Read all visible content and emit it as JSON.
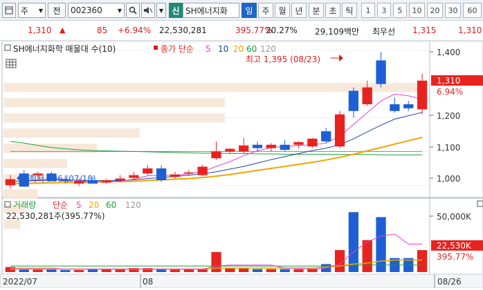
{
  "toolbar": {
    "market": "주",
    "period_label": "전",
    "code": "002360",
    "stock_name_tag": "신",
    "stock_name": "SH에너지화",
    "periods": [
      "일",
      "주",
      "월",
      "년",
      "분",
      "초",
      "틱"
    ],
    "active_period": "일",
    "intervals": [
      "1",
      "3",
      "5",
      "10",
      "20",
      "30",
      "60"
    ]
  },
  "quote": {
    "price": "1,310",
    "change": "85",
    "change_pct": "+6.94%",
    "volume": "22,530,281",
    "volume_ratio": "395.77%",
    "turnover": "20.27%",
    "amount": "29,109백만",
    "bid_label": "최우선",
    "bid_price": "1,315",
    "ask_price": "1,310"
  },
  "price_panel": {
    "title": "SH에너지화학 매물대 수(10)",
    "ma_label": "종가 단순",
    "ma_periods": [
      "5",
      "10",
      "20",
      "60",
      "120"
    ],
    "high_annotation": "최고 1,395 (08/23)",
    "low_annotation": "최저 996 (07/18)",
    "current_price_tag": "1,310",
    "current_pct_tag": "6.94%",
    "y_ticks": [
      "1,400",
      "1,300",
      "1,200",
      "1,100",
      "1,000"
    ]
  },
  "volume_panel": {
    "title_label": "거래량",
    "ma_label": "단순",
    "ma_periods": [
      "5",
      "20",
      "60",
      "120"
    ],
    "volume_text": "22,530,281주(395.77%)",
    "y_ticks": [
      "50,000K"
    ],
    "current_volume_tag": "22,530K",
    "current_pct_tag": "395.77%"
  },
  "x_axis": {
    "labels": [
      "2022/07",
      "08",
      "08/26"
    ]
  },
  "colors": {
    "up": "#e8231f",
    "down": "#1e5fd6",
    "ma5": "#e83cc9",
    "ma10": "#1f3fa8",
    "ma20": "#f0a500",
    "ma60": "#1a9e3a",
    "ma120": "#8a8a8a"
  },
  "chart_data": {
    "type": "candlestick",
    "ylim": [
      970,
      1420
    ],
    "candles": [
      {
        "o": 1000,
        "h": 1030,
        "l": 990,
        "c": 1018
      },
      {
        "o": 1035,
        "h": 1045,
        "l": 995,
        "c": 996
      },
      {
        "o": 1030,
        "h": 1040,
        "l": 1020,
        "c": 1035
      },
      {
        "o": 1035,
        "h": 1040,
        "l": 1012,
        "c": 1012
      },
      {
        "o": 1015,
        "h": 1030,
        "l": 1005,
        "c": 1012
      },
      {
        "o": 1005,
        "h": 1020,
        "l": 998,
        "c": 1013
      },
      {
        "o": 1015,
        "h": 1025,
        "l": 1008,
        "c": 1005
      },
      {
        "o": 1008,
        "h": 1020,
        "l": 1005,
        "c": 1015
      },
      {
        "o": 1015,
        "h": 1030,
        "l": 1010,
        "c": 1020
      },
      {
        "o": 1022,
        "h": 1040,
        "l": 1018,
        "c": 1030
      },
      {
        "o": 1035,
        "h": 1060,
        "l": 1030,
        "c": 1050
      },
      {
        "o": 1050,
        "h": 1060,
        "l": 1010,
        "c": 1015
      },
      {
        "o": 1025,
        "h": 1040,
        "l": 1020,
        "c": 1032
      },
      {
        "o": 1035,
        "h": 1045,
        "l": 1028,
        "c": 1038
      },
      {
        "o": 1030,
        "h": 1060,
        "l": 1028,
        "c": 1055
      },
      {
        "o": 1080,
        "h": 1130,
        "l": 1075,
        "c": 1100
      },
      {
        "o": 1100,
        "h": 1110,
        "l": 1095,
        "c": 1108
      },
      {
        "o": 1100,
        "h": 1140,
        "l": 1095,
        "c": 1118
      },
      {
        "o": 1120,
        "h": 1130,
        "l": 1100,
        "c": 1110
      },
      {
        "o": 1110,
        "h": 1125,
        "l": 1100,
        "c": 1120
      },
      {
        "o": 1120,
        "h": 1135,
        "l": 1100,
        "c": 1105
      },
      {
        "o": 1120,
        "h": 1130,
        "l": 1110,
        "c": 1128
      },
      {
        "o": 1115,
        "h": 1140,
        "l": 1110,
        "c": 1138
      },
      {
        "o": 1160,
        "h": 1170,
        "l": 1125,
        "c": 1130
      },
      {
        "o": 1115,
        "h": 1220,
        "l": 1110,
        "c": 1210
      },
      {
        "o": 1280,
        "h": 1290,
        "l": 1200,
        "c": 1220
      },
      {
        "o": 1240,
        "h": 1310,
        "l": 1235,
        "c": 1290
      },
      {
        "o": 1370,
        "h": 1395,
        "l": 1290,
        "c": 1300
      },
      {
        "o": 1240,
        "h": 1260,
        "l": 1215,
        "c": 1220
      },
      {
        "o": 1240,
        "h": 1250,
        "l": 1220,
        "c": 1228
      },
      {
        "o": 1225,
        "h": 1330,
        "l": 1210,
        "c": 1310
      }
    ],
    "ma5": [
      1010,
      1014,
      1016,
      1019,
      1018,
      1014,
      1012,
      1010,
      1012,
      1018,
      1028,
      1030,
      1030,
      1034,
      1040,
      1056,
      1070,
      1088,
      1102,
      1112,
      1115,
      1118,
      1120,
      1125,
      1145,
      1180,
      1215,
      1250,
      1270,
      1265,
      1255
    ],
    "ma10": [
      1012,
      1013,
      1014,
      1015,
      1016,
      1015,
      1014,
      1014,
      1014,
      1016,
      1020,
      1023,
      1026,
      1030,
      1034,
      1040,
      1048,
      1056,
      1066,
      1076,
      1085,
      1094,
      1103,
      1110,
      1120,
      1138,
      1158,
      1178,
      1196,
      1206,
      1216
    ],
    "ma20": [
      1005,
      1005,
      1006,
      1007,
      1008,
      1008,
      1009,
      1010,
      1011,
      1012,
      1014,
      1016,
      1018,
      1020,
      1023,
      1027,
      1032,
      1038,
      1044,
      1050,
      1056,
      1062,
      1068,
      1075,
      1083,
      1092,
      1102,
      1112,
      1122,
      1132,
      1142
    ],
    "ma60": [
      1130,
      1125,
      1118,
      1112,
      1108,
      1105,
      1103,
      1102,
      1101,
      1100,
      1099,
      1098,
      1097,
      1096,
      1095,
      1095,
      1094,
      1094,
      1093,
      1093,
      1092,
      1092,
      1092,
      1092,
      1091,
      1091,
      1091,
      1090,
      1090,
      1090,
      1090
    ],
    "ma120": [
      1100,
      1100,
      1100,
      1100,
      1100,
      1100,
      1100,
      1100,
      1100,
      1100,
      1100,
      1100,
      1100,
      1100,
      1100,
      1100,
      1100,
      1100,
      1100,
      1100,
      1100,
      1100,
      1100,
      1100,
      1100,
      1100,
      1100,
      1100,
      1100,
      1100,
      1100
    ],
    "volume_profile": [
      0.98,
      0.52,
      0.52,
      0.32,
      0.22,
      0.15,
      0.1,
      0.08,
      0.05,
      0.04
    ],
    "volumes": [
      5,
      3,
      3,
      3,
      2,
      2,
      3,
      3,
      3,
      4,
      4,
      3,
      3,
      3,
      3,
      20,
      4,
      4,
      3,
      3,
      3,
      3,
      3,
      8,
      22,
      60,
      32,
      55,
      14,
      14,
      22
    ],
    "vol_ma5": [
      4,
      4,
      4,
      4,
      3,
      3,
      3,
      3,
      3,
      3,
      3,
      3,
      3,
      3,
      3,
      6,
      7,
      7,
      7,
      7,
      4,
      4,
      3,
      4,
      8,
      20,
      30,
      36,
      38,
      28,
      28
    ],
    "vol_ma20": [
      3,
      3,
      3,
      3,
      3,
      3,
      3,
      3,
      3,
      3,
      3,
      3,
      3,
      3,
      3,
      4,
      4,
      4,
      4,
      4,
      4,
      4,
      4,
      5,
      6,
      8,
      9,
      11,
      12,
      12,
      12
    ],
    "vol_ma60": [
      6,
      6,
      6,
      6,
      6,
      6,
      6,
      6,
      6,
      6,
      6,
      6,
      6,
      6,
      6,
      6,
      6,
      6,
      6,
      6,
      6,
      6,
      6,
      6,
      6,
      7,
      7,
      7,
      7,
      7,
      7
    ],
    "vol_ylim": [
      0,
      65
    ]
  }
}
